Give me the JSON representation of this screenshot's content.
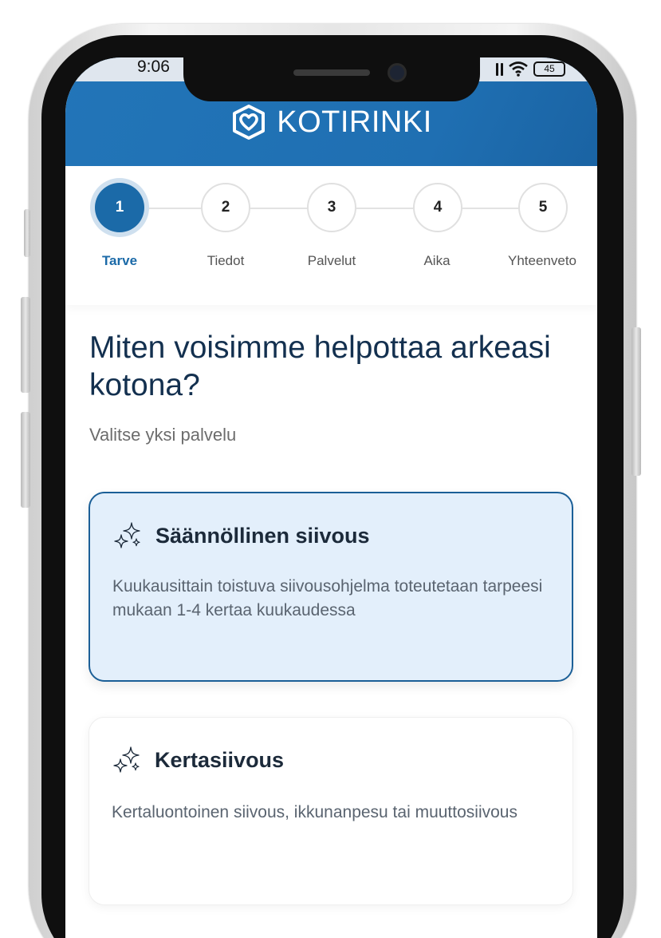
{
  "status_bar": {
    "time": "9:06",
    "battery": "45"
  },
  "header": {
    "brand": "KOTIRINKI"
  },
  "stepper": {
    "steps": [
      {
        "number": "1",
        "label": "Tarve",
        "active": true
      },
      {
        "number": "2",
        "label": "Tiedot",
        "active": false
      },
      {
        "number": "3",
        "label": "Palvelut",
        "active": false
      },
      {
        "number": "4",
        "label": "Aika",
        "active": false
      },
      {
        "number": "5",
        "label": "Yhteenveto",
        "active": false
      }
    ]
  },
  "main": {
    "headline": "Miten voisimme helpottaa arkeasi kotona?",
    "subline": "Valitse yksi palvelu",
    "options": [
      {
        "title": "Säännöllinen siivous",
        "description": "Kuukausittain toistuva siivousohjelma toteutetaan tarpeesi mukaan 1-4 kertaa kuukaudessa",
        "icon": "sparkles-icon",
        "selected": true
      },
      {
        "title": "Kertasiivous",
        "description": "Kertaluontoinen siivous, ikkunanpesu tai muuttosiivous",
        "icon": "sparkles-icon",
        "selected": false
      }
    ]
  },
  "colors": {
    "primary": "#1b6aa8",
    "heading": "#13304f",
    "selected_bg": "#e3effb"
  }
}
